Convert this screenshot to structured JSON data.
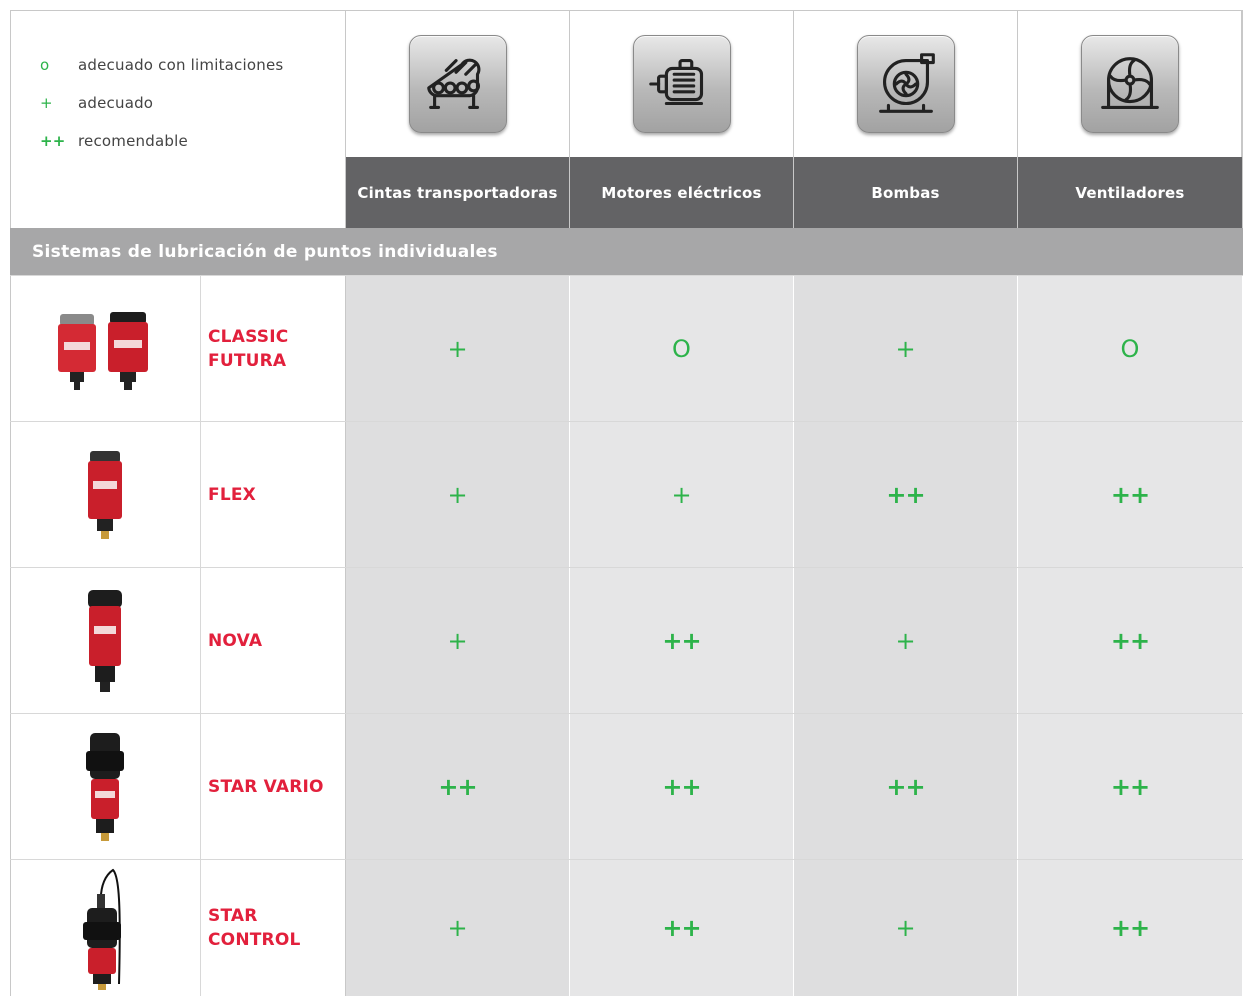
{
  "legend": [
    {
      "symbol": "o",
      "label": "adecuado con limitaciones"
    },
    {
      "symbol": "+",
      "label": "adecuado"
    },
    {
      "symbol": "++",
      "label": "recomendable"
    }
  ],
  "columns": [
    {
      "label": "Cintas transportadoras",
      "icon": "conveyor-belt-icon"
    },
    {
      "label": "Motores eléctricos",
      "icon": "electric-motor-icon"
    },
    {
      "label": "Bombas",
      "icon": "pump-icon"
    },
    {
      "label": "Ventiladores",
      "icon": "fan-icon"
    }
  ],
  "section_title": "Sistemas de lubricación de puntos individuales",
  "rows": [
    {
      "name_line1": "CLASSIC",
      "name_line2": "FUTURA",
      "image": "classic-futura-lubricator-image",
      "values": [
        "+",
        "O",
        "+",
        "O"
      ]
    },
    {
      "name_line1": "FLEX",
      "name_line2": "",
      "image": "flex-lubricator-image",
      "values": [
        "+",
        "+",
        "++",
        "++"
      ]
    },
    {
      "name_line1": "NOVA",
      "name_line2": "",
      "image": "nova-lubricator-image",
      "values": [
        "+",
        "++",
        "+",
        "++"
      ]
    },
    {
      "name_line1": "STAR VARIO",
      "name_line2": "",
      "image": "star-vario-lubricator-image",
      "values": [
        "++",
        "++",
        "++",
        "++"
      ]
    },
    {
      "name_line1": "STAR",
      "name_line2": "CONTROL",
      "image": "star-control-lubricator-image",
      "values": [
        "+",
        "++",
        "+",
        "++"
      ]
    }
  ],
  "colors": {
    "accent_green": "#2db34a",
    "product_red": "#e2203c",
    "header_dark": "#636365",
    "section_gray": "#a7a7a8"
  }
}
